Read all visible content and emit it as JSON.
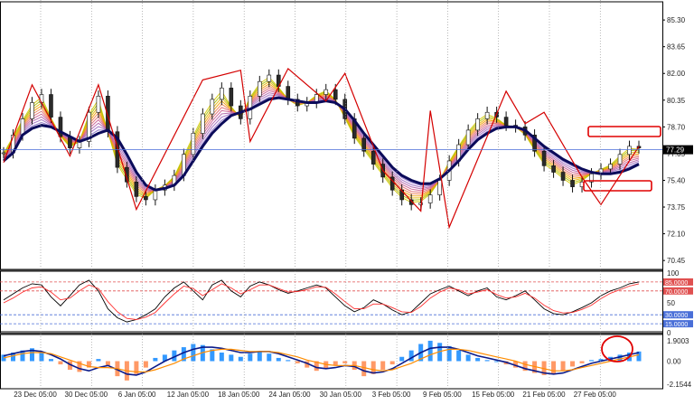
{
  "chart_data": [
    {
      "type": "line",
      "role": "price-panel",
      "x": [
        "23 Dec 05:00",
        "30 Dec 05:00",
        "6 Jan 05:00",
        "12 Jan 05:00",
        "18 Jan 05:00",
        "24 Jan 05:00",
        "30 Jan 05:00",
        "3 Feb 05:00",
        "9 Feb 05:00",
        "15 Feb 05:00",
        "21 Feb 05:00",
        "27 Feb 05:00"
      ],
      "y_ticks": [
        "85.30",
        "83.65",
        "82.00",
        "80.35",
        "78.70",
        "77.05",
        "75.40",
        "73.75",
        "72.10",
        "70.45"
      ],
      "ylim": [
        69.9,
        86.2
      ],
      "current_price": "77.29",
      "series": [
        {
          "values": [
            77.1,
            78.2,
            79.2,
            80.2,
            80.7,
            79.3,
            78.1,
            77.4,
            77.8,
            79.6,
            80.6,
            78.4,
            76.2,
            75.3,
            74.4,
            74.2,
            74.8,
            75.1,
            75.7,
            77.0,
            78.3,
            79.5,
            80.4,
            81.1,
            80.0,
            79.2,
            80.6,
            81.5,
            81.9,
            81.2,
            80.4,
            80.0,
            80.2,
            80.7,
            81.0,
            80.4,
            79.2,
            78.0,
            77.2,
            76.4,
            75.6,
            74.8,
            74.2,
            73.9,
            74.0,
            74.5,
            75.4,
            76.6,
            77.6,
            78.5,
            79.2,
            79.6,
            79.3,
            78.8,
            78.7,
            78.2,
            77.2,
            76.3,
            75.9,
            75.4,
            75.0,
            75.3,
            75.8,
            76.1,
            76.4,
            77.0,
            77.5,
            77.4
          ]
        },
        {
          "values": [
            76.6,
            77.1,
            78.2,
            78.6,
            78.8,
            78.7,
            78.4,
            78.1,
            77.8,
            78.0,
            78.3,
            78.5,
            78.0,
            77.0,
            75.9,
            75.1,
            74.8,
            74.9,
            75.1,
            75.7,
            76.6,
            77.5,
            78.3,
            78.9,
            79.4,
            79.6,
            79.8,
            80.1,
            80.4,
            80.5,
            80.4,
            80.3,
            80.2,
            80.2,
            80.3,
            80.2,
            79.8,
            79.1,
            78.3,
            77.6,
            76.9,
            76.2,
            75.7,
            75.4,
            75.2,
            75.2,
            75.5,
            76.0,
            76.6,
            77.3,
            77.9,
            78.3,
            78.6,
            78.7,
            78.7,
            78.5,
            78.0,
            77.5,
            77.1,
            76.7,
            76.4,
            76.1,
            75.9,
            75.8,
            75.8,
            75.9,
            76.1,
            76.4
          ]
        }
      ],
      "zigzag": [
        [
          0,
          76.5
        ],
        [
          3,
          81.3
        ],
        [
          7,
          76.9
        ],
        [
          10,
          81.3
        ],
        [
          14,
          73.6
        ],
        [
          21,
          81.6
        ],
        [
          25,
          82.2
        ],
        [
          26,
          77.8
        ],
        [
          30,
          82.3
        ],
        [
          34,
          80.3
        ],
        [
          36,
          82.0
        ],
        [
          40,
          76.0
        ],
        [
          44,
          73.5
        ],
        [
          45,
          79.7
        ],
        [
          47,
          72.5
        ],
        [
          53,
          80.9
        ],
        [
          55,
          78.9
        ],
        [
          57,
          79.6
        ],
        [
          61,
          75.6
        ],
        [
          63,
          73.9
        ],
        [
          67,
          77.5
        ]
      ],
      "levels": [
        77.29
      ]
    },
    {
      "type": "line",
      "role": "stochastic-panel",
      "y_ticks": [
        "100",
        "85.0000",
        "70.0000",
        "50",
        "30.0000",
        "15.0000",
        "0"
      ],
      "ylim": [
        0,
        100
      ],
      "levels": [
        85,
        70,
        30,
        15
      ],
      "series": [
        {
          "values": [
            55,
            65,
            75,
            82,
            80,
            60,
            45,
            62,
            80,
            88,
            70,
            40,
            25,
            18,
            22,
            30,
            40,
            60,
            75,
            85,
            70,
            55,
            80,
            88,
            70,
            60,
            78,
            85,
            80,
            72,
            66,
            70,
            75,
            80,
            75,
            60,
            45,
            35,
            42,
            55,
            48,
            38,
            30,
            35,
            50,
            65,
            72,
            78,
            70,
            62,
            70,
            75,
            60,
            55,
            62,
            70,
            55,
            40,
            32,
            30,
            35,
            42,
            50,
            62,
            70,
            75,
            82,
            85
          ]
        },
        {
          "values": [
            50,
            58,
            68,
            75,
            77,
            68,
            55,
            58,
            70,
            80,
            74,
            52,
            35,
            24,
            22,
            26,
            34,
            50,
            65,
            78,
            74,
            62,
            72,
            82,
            75,
            65,
            72,
            80,
            80,
            74,
            68,
            69,
            72,
            77,
            76,
            65,
            52,
            40,
            40,
            48,
            48,
            42,
            35,
            34,
            44,
            58,
            68,
            75,
            72,
            65,
            68,
            72,
            64,
            58,
            60,
            66,
            58,
            46,
            37,
            33,
            34,
            39,
            46,
            57,
            66,
            72,
            78,
            82
          ]
        }
      ]
    },
    {
      "type": "bar",
      "role": "macd-panel",
      "y_ticks": [
        "1.9003",
        "0.00",
        "-2.1544"
      ],
      "ylim": [
        -2.4,
        2.4
      ],
      "values": [
        0.6,
        0.8,
        1.0,
        1.2,
        0.8,
        0.2,
        -0.3,
        -0.8,
        -1.0,
        -0.6,
        0.2,
        -0.4,
        -1.4,
        -1.8,
        -1.2,
        -0.6,
        0.3,
        0.6,
        1.0,
        1.3,
        1.6,
        1.5,
        1.1,
        0.8,
        0.6,
        0.4,
        0.7,
        0.9,
        0.7,
        0.3,
        0.1,
        -0.2,
        -0.6,
        -0.9,
        -0.7,
        -0.4,
        -0.2,
        -0.8,
        -1.4,
        -1.2,
        -0.8,
        -0.3,
        0.4,
        1.0,
        1.6,
        1.9,
        1.7,
        1.4,
        1.0,
        0.6,
        0.3,
        0.1,
        0.0,
        -0.3,
        -0.6,
        -0.9,
        -1.1,
        -1.3,
        -1.2,
        -0.9,
        -0.5,
        -0.2,
        0.1,
        0.2,
        0.4,
        0.6,
        0.8,
        0.9
      ],
      "series": [
        {
          "values": [
            0.5,
            0.7,
            0.9,
            1.0,
            0.9,
            0.6,
            0.2,
            -0.3,
            -0.7,
            -0.9,
            -0.6,
            -0.4,
            -0.8,
            -1.2,
            -1.3,
            -1.0,
            -0.5,
            0.0,
            0.4,
            0.8,
            1.1,
            1.3,
            1.3,
            1.2,
            1.0,
            0.8,
            0.8,
            0.9,
            0.9,
            0.7,
            0.4,
            0.1,
            -0.2,
            -0.6,
            -0.7,
            -0.6,
            -0.4,
            -0.5,
            -0.9,
            -1.1,
            -1.0,
            -0.7,
            -0.2,
            0.3,
            0.8,
            1.2,
            1.3,
            1.3,
            1.1,
            0.8,
            0.5,
            0.3,
            0.1,
            -0.1,
            -0.4,
            -0.7,
            -0.9,
            -1.1,
            -1.2,
            -1.1,
            -0.8,
            -0.5,
            -0.2,
            0.0,
            0.2,
            0.4,
            0.6,
            0.8
          ]
        },
        {
          "values": [
            0.3,
            0.5,
            0.7,
            0.8,
            0.8,
            0.7,
            0.4,
            0.1,
            -0.2,
            -0.5,
            -0.6,
            -0.6,
            -0.7,
            -0.9,
            -1.0,
            -1.0,
            -0.8,
            -0.5,
            -0.2,
            0.2,
            0.5,
            0.8,
            1.0,
            1.1,
            1.1,
            1.0,
            0.9,
            0.9,
            0.9,
            0.8,
            0.6,
            0.4,
            0.1,
            -0.1,
            -0.3,
            -0.4,
            -0.4,
            -0.4,
            -0.6,
            -0.8,
            -0.9,
            -0.8,
            -0.5,
            -0.2,
            0.2,
            0.6,
            0.9,
            1.1,
            1.1,
            1.0,
            0.8,
            0.6,
            0.4,
            0.2,
            0.0,
            -0.3,
            -0.5,
            -0.7,
            -0.9,
            -0.9,
            -0.8,
            -0.6,
            -0.4,
            -0.2,
            0.0,
            0.2,
            0.4,
            0.6
          ]
        }
      ]
    }
  ],
  "colors": {
    "ma_slow": "#0b0b5a",
    "zigzag": "#d40000",
    "current_line": "#4a6fd8",
    "price_label_bg": "#000000",
    "hist_pos": "#3399ff",
    "hist_neg": "#ff9966",
    "macd_line": "#0a1a8a",
    "signal_line": "#ff8c00",
    "stoch_main": "#000000",
    "stoch_signal": "#ff3030",
    "highlight": "#e00000"
  }
}
